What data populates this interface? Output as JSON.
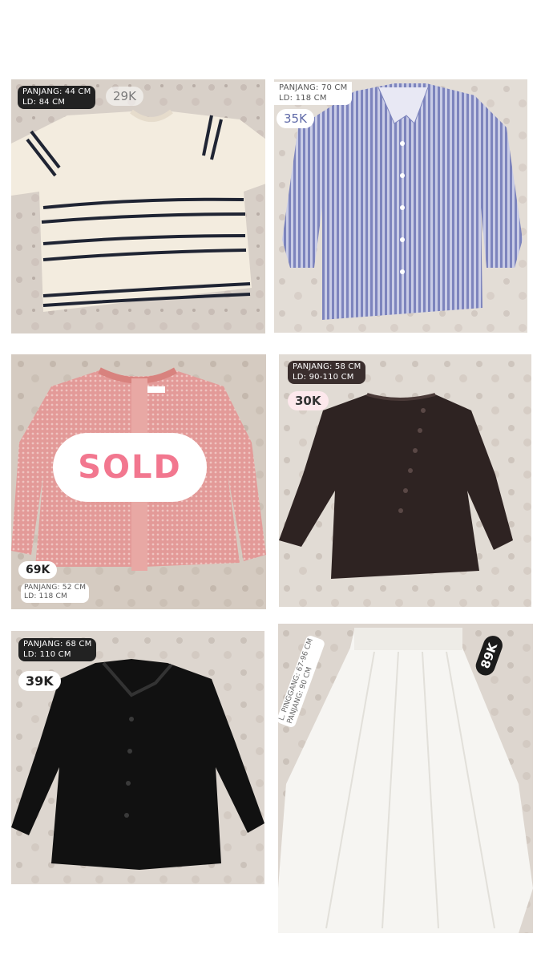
{
  "items": [
    {
      "length": "PANJANG: 44 CM",
      "chest": "LD: 84 CM",
      "price": "29K"
    },
    {
      "length": "PANJANG: 70 CM",
      "chest": "LD: 118 CM",
      "price": "35K"
    },
    {
      "sold": "SOLD",
      "price": "69K",
      "length": "PANJANG: 52 CM",
      "chest": "LD: 118 CM"
    },
    {
      "length": "PANJANG: 58 CM",
      "chest": "LD: 90-110 CM",
      "price": "30K"
    },
    {
      "length": "PANJANG: 68 CM",
      "chest": "LD: 110 CM",
      "price": "39K"
    },
    {
      "waist": "L. PINGGANG: 67-96 CM",
      "length": "PANJANG: 90 CM",
      "price": "89K"
    }
  ],
  "colors": {
    "background": "#ffffff",
    "fabric_bg": "#d9d2cb",
    "sold_text": "#f2778f",
    "striped_tee": "#f3ecdf",
    "blue_shirt": "#8f96c8",
    "pink_cardigan": "#e39a98",
    "brown_top": "#2e2322",
    "black_shirt": "#111111",
    "white_skirt": "#f6f5f2"
  }
}
